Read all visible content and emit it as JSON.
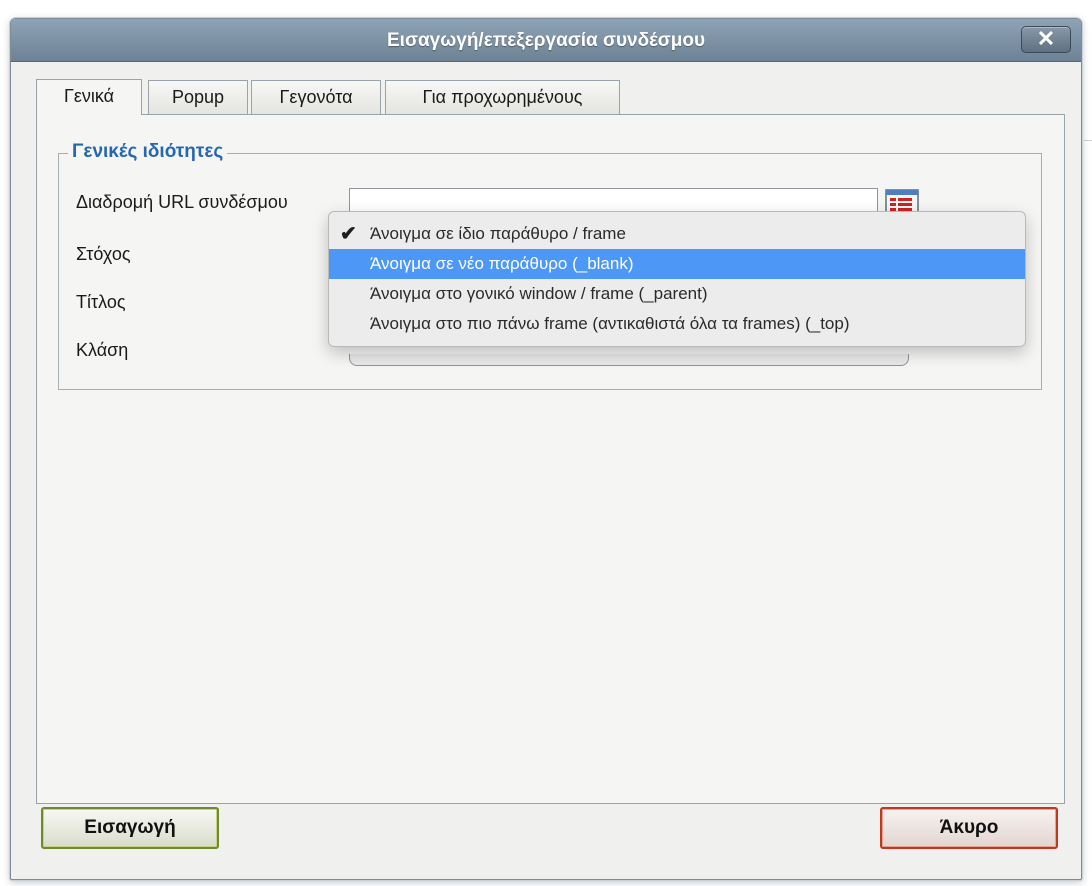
{
  "window": {
    "title": "Εισαγωγή/επεξεργασία συνδέσμου",
    "close_label": "✕"
  },
  "tabs": [
    {
      "label": "Γενικά",
      "active": true
    },
    {
      "label": "Popup",
      "active": false
    },
    {
      "label": "Γεγονότα",
      "active": false
    },
    {
      "label": "Για προχωρημένους",
      "active": false
    }
  ],
  "general": {
    "legend": "Γενικές ιδιότητες",
    "url_label": "Διαδρομή URL συνδέσμου",
    "url_value": "",
    "target_label": "Στόχος",
    "title_label": "Τίτλος",
    "class_label": "Κλάση"
  },
  "target_dropdown": {
    "options": [
      {
        "label": "Άνοιγμα σε ίδιο παράθυρο / frame",
        "checked": true
      },
      {
        "label": "Άνοιγμα σε νέο παράθυρο (_blank)",
        "highlighted": true
      },
      {
        "label": "Άνοιγμα στο γονικό window / frame (_parent)"
      },
      {
        "label": "Άνοιγμα στο πιο πάνω frame (αντικαθιστά όλα τα frames) (_top)"
      }
    ],
    "check_mark": "✔"
  },
  "buttons": {
    "insert": "Εισαγωγή",
    "cancel": "Άκυρο"
  },
  "colors": {
    "titlebar": "#7b90a2",
    "legend": "#2767b0",
    "highlight": "#4d98f7",
    "insert_border": "#6f8a2a",
    "cancel_border": "#c0381e"
  },
  "icons": {
    "browse": "file-browser-icon",
    "close": "close-icon",
    "check": "checkmark-icon"
  }
}
